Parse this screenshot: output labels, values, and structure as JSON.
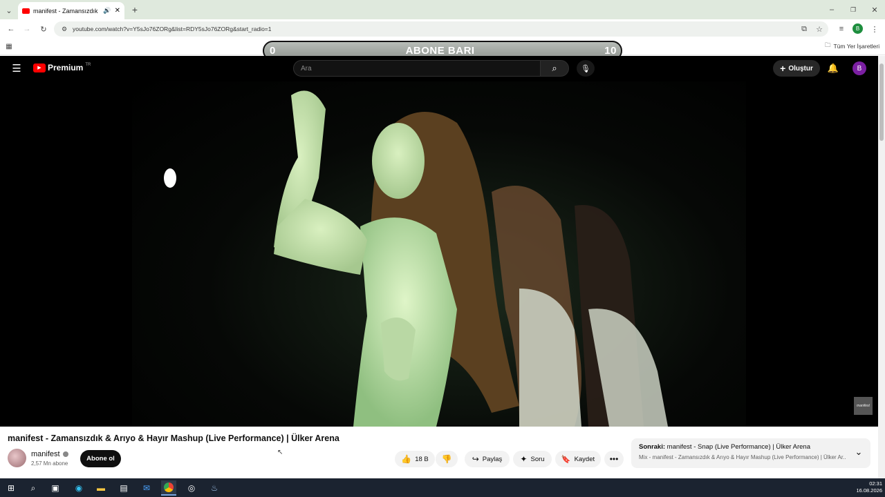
{
  "browser": {
    "tab_title": "manifest - Zamansızdık & A",
    "url": "youtube.com/watch?v=Y5sJo76ZORg&list=RDY5sJo76ZORg&start_radio=1",
    "bookmarks_all": "Tüm Yer İşaretleri",
    "profile_letter": "B"
  },
  "overlay": {
    "left_value": "0",
    "title": "ABONE BARI",
    "right_value": "10"
  },
  "youtube": {
    "logo_text": "Premium",
    "region": "TR",
    "search_placeholder": "Ara",
    "create_label": "Oluştur",
    "avatar_letter": "B"
  },
  "video": {
    "title": "manifest - Zamansızdık & Arıyo & Hayır Mashup (Live Performance) | Ülker Arena",
    "channel": "manifest",
    "subscribers": "2,57 Mn abone",
    "subscribe_label": "Abone ol",
    "likes": "18 B",
    "share_label": "Paylaş",
    "ask_label": "Soru",
    "save_label": "Kaydet",
    "watermark": "manifest"
  },
  "next": {
    "label": "Sonraki:",
    "title": "manifest - Snap (Live Performance) | Ülker Arena",
    "subtitle": "Mix - manifest - Zamansızdık & Arıyo & Hayır Mashup (Live Performance) | Ülker Ar..."
  },
  "taskbar": {
    "time": "02:31",
    "date": "16.08.2026"
  },
  "colors": {
    "youtube_red": "#ff0000",
    "tab_strip": "#dfe9dd",
    "avatar_purple": "#7b1fa2"
  }
}
